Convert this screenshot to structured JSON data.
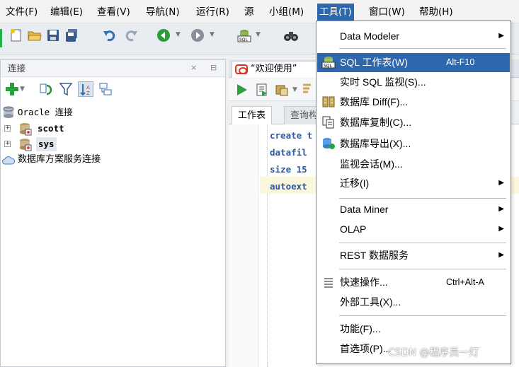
{
  "menubar": {
    "items": [
      {
        "label": "文件(F)"
      },
      {
        "label": "编辑(E)"
      },
      {
        "label": "查看(V)"
      },
      {
        "label": "导航(N)"
      },
      {
        "label": "运行(R)"
      },
      {
        "label": "源"
      },
      {
        "label": "小组(M)"
      },
      {
        "label": "工具(T)"
      },
      {
        "label": "窗口(W)"
      },
      {
        "label": "帮助(H)"
      }
    ],
    "active_index": 7
  },
  "toolbar": {
    "icons": [
      "new-file-icon",
      "open-folder-icon",
      "save-icon",
      "save-all-icon",
      "undo-icon",
      "redo-icon",
      "back-icon",
      "forward-icon",
      "sql-icon",
      "binoculars-icon"
    ]
  },
  "connections_panel": {
    "title": "连接",
    "tree": [
      {
        "label": "Oracle 连接"
      },
      {
        "label": "scott"
      },
      {
        "label": "sys"
      },
      {
        "label": "数据库方案服务连接"
      }
    ]
  },
  "document": {
    "tab_label": "“欢迎使用”",
    "sub_tabs": [
      {
        "label": "工作表"
      },
      {
        "label": "查询构"
      }
    ],
    "code_lines": [
      "create t",
      "datafil",
      "size 15",
      "autoext"
    ]
  },
  "tools_menu": {
    "items": [
      {
        "label": "Data Modeler",
        "shortcut": "",
        "submenu": true
      },
      {
        "label": "SQL 工作表(W)",
        "shortcut": "Alt-F10",
        "submenu": false,
        "icon": "sql-worksheet-icon"
      },
      {
        "label": "实时 SQL 监视(S)...",
        "shortcut": "",
        "submenu": false
      },
      {
        "label": "数据库 Diff(F)...",
        "shortcut": "",
        "submenu": false,
        "icon": "database-diff-icon"
      },
      {
        "label": "数据库复制(C)...",
        "shortcut": "",
        "submenu": false,
        "icon": "database-copy-icon"
      },
      {
        "label": "数据库导出(X)...",
        "shortcut": "",
        "submenu": false,
        "icon": "database-export-icon"
      },
      {
        "label": "监视会话(M)...",
        "shortcut": "",
        "submenu": false
      },
      {
        "label": "迁移(I)",
        "shortcut": "",
        "submenu": true
      },
      {
        "label": "Data Miner",
        "shortcut": "",
        "submenu": true
      },
      {
        "label": "OLAP",
        "shortcut": "",
        "submenu": true
      },
      {
        "label": "REST 数据服务",
        "shortcut": "",
        "submenu": true
      },
      {
        "label": "快速操作...",
        "shortcut": "Ctrl+Alt-A",
        "submenu": false,
        "icon": "list-icon"
      },
      {
        "label": "外部工具(X)...",
        "shortcut": "",
        "submenu": false
      },
      {
        "label": "功能(F)...",
        "shortcut": "",
        "submenu": false
      },
      {
        "label": "首选项(P)...",
        "shortcut": "",
        "submenu": false
      }
    ],
    "highlighted_index": 1,
    "submenu_glyph": "▶"
  },
  "watermark": "CSDN @程序员一灯",
  "colors": {
    "menu_highlight": "#2f67ad",
    "toolbar_bg": "#e9edf2",
    "code_keyword": "#2b57a8"
  }
}
